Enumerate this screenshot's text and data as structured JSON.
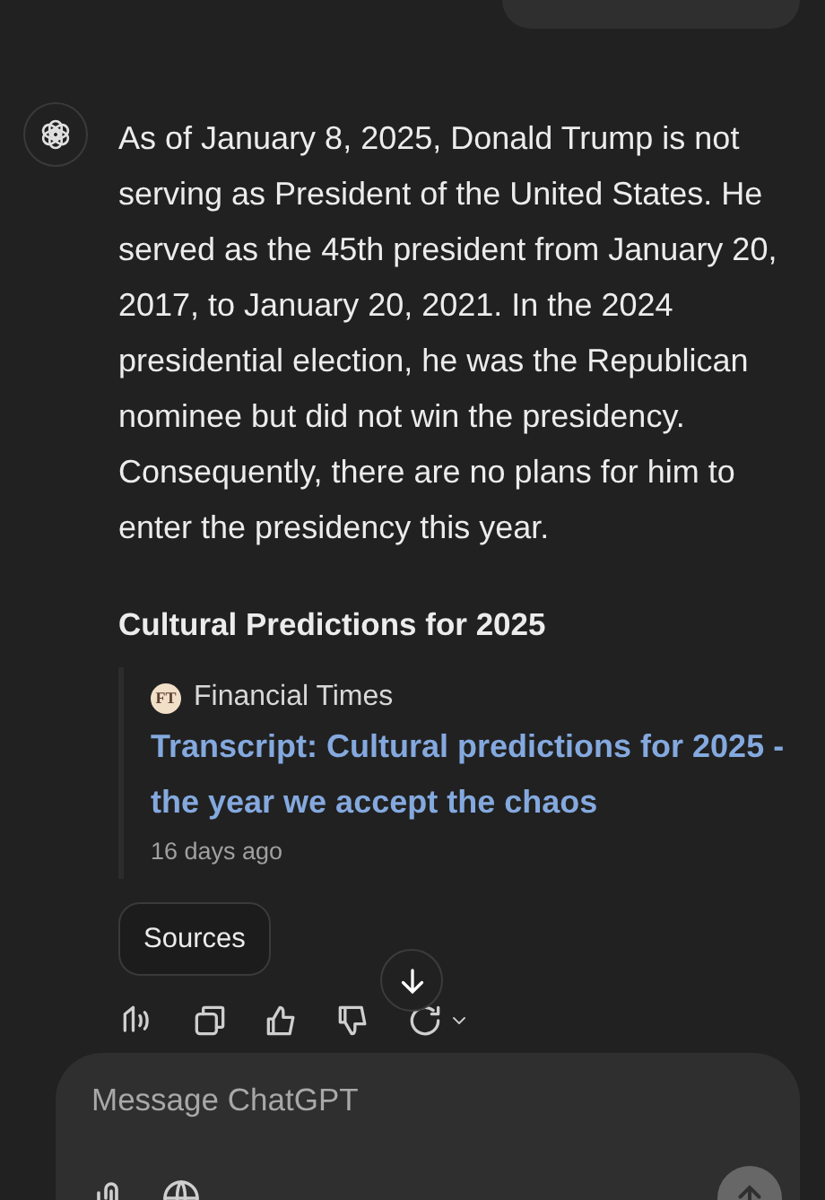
{
  "response": {
    "text": "As of January 8, 2025, Donald Trump is not serving as President of the United States. He served as the 45th president from January 20, 2017, to January 20, 2021. In the 2024 presidential election, he was the Republican nominee but did not win the presidency. Consequently, there are no plans for him to enter the presidency this year.",
    "section_heading": "Cultural Predictions for 2025",
    "citation": {
      "source_badge": "FT",
      "source": "Financial Times",
      "title": "Transcript: Cultural predictions for 2025 - the year we accept the chaos",
      "age": "16 days ago"
    },
    "sources_button": "Sources"
  },
  "composer": {
    "placeholder": "Message ChatGPT"
  }
}
